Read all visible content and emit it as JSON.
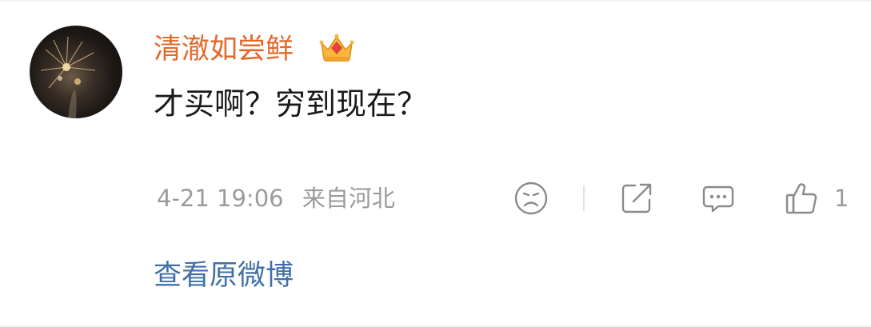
{
  "comment": {
    "username": "清澈如尝鲜",
    "text": "才买啊？穷到现在？",
    "time": "4-21 19:06",
    "location": "来自河北",
    "like_count": "1"
  },
  "badge_icon": "crown-vip-icon",
  "actions": [
    "dislike-face-icon",
    "share-icon",
    "reply-icon",
    "like-icon"
  ],
  "view_original_label": "查看原微博",
  "colors": {
    "username": "#e4692a",
    "link": "#3f6fa6",
    "meta": "#9b9b9b",
    "text": "#1a1a1a"
  }
}
